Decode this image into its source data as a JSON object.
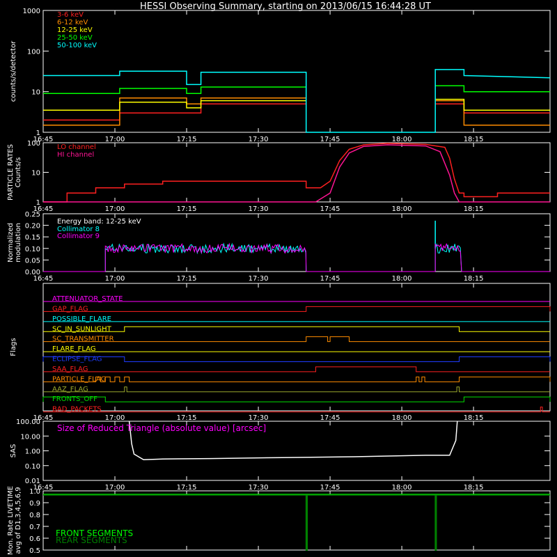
{
  "title": "HESSI Observing Summary, starting on 2013/06/15 16:44:28 UT",
  "chart_data": [
    {
      "id": "count_rates",
      "type": "line",
      "ylabel": "counts/s/detector",
      "yscale": "log",
      "ylim": [
        1,
        1000
      ],
      "yticks": [
        "1",
        "10",
        "100",
        "1000"
      ],
      "xlim_min": [
        0,
        106
      ],
      "xticks": [
        "16:45",
        "17:00",
        "17:15",
        "17:30",
        "17:45",
        "18:00",
        "18:15"
      ],
      "series": [
        {
          "name": "3-6 keV",
          "color": "#ff2020",
          "points": [
            [
              0,
              2
            ],
            [
              16,
              2
            ],
            [
              16,
              3
            ],
            [
              33,
              3
            ],
            [
              33,
              5
            ],
            [
              55,
              5
            ],
            [
              55,
              null
            ],
            [
              82,
              null
            ],
            [
              82,
              5
            ],
            [
              88,
              5
            ],
            [
              88,
              3
            ],
            [
              106,
              3
            ]
          ]
        },
        {
          "name": "6-12 keV",
          "color": "#ff8c00",
          "points": [
            [
              0,
              1.5
            ],
            [
              16,
              1.5
            ],
            [
              16,
              7
            ],
            [
              30,
              7
            ],
            [
              30,
              5
            ],
            [
              33,
              5
            ],
            [
              33,
              7
            ],
            [
              55,
              7
            ],
            [
              55,
              null
            ],
            [
              82,
              null
            ],
            [
              82,
              6
            ],
            [
              88,
              6
            ],
            [
              88,
              1.5
            ],
            [
              106,
              1.5
            ]
          ]
        },
        {
          "name": "12-25 keV",
          "color": "#ffff00",
          "points": [
            [
              0,
              3.5
            ],
            [
              16,
              3.5
            ],
            [
              16,
              5.5
            ],
            [
              30,
              5.5
            ],
            [
              30,
              4
            ],
            [
              33,
              4
            ],
            [
              33,
              6
            ],
            [
              55,
              6
            ],
            [
              55,
              null
            ],
            [
              82,
              null
            ],
            [
              82,
              6.5
            ],
            [
              88,
              6.5
            ],
            [
              88,
              3.5
            ],
            [
              106,
              3.5
            ]
          ]
        },
        {
          "name": "25-50 keV",
          "color": "#00ff00",
          "points": [
            [
              0,
              9
            ],
            [
              16,
              9
            ],
            [
              16,
              12
            ],
            [
              30,
              12
            ],
            [
              30,
              9
            ],
            [
              33,
              9
            ],
            [
              33,
              13
            ],
            [
              55,
              13
            ],
            [
              55,
              null
            ],
            [
              82,
              null
            ],
            [
              82,
              14
            ],
            [
              88,
              14
            ],
            [
              88,
              10
            ],
            [
              106,
              10
            ]
          ]
        },
        {
          "name": "50-100 keV",
          "color": "#00ffff",
          "points": [
            [
              0,
              25
            ],
            [
              16,
              25
            ],
            [
              16,
              32
            ],
            [
              30,
              32
            ],
            [
              30,
              15
            ],
            [
              33,
              15
            ],
            [
              33,
              30
            ],
            [
              55,
              30
            ],
            [
              55,
              1
            ],
            [
              82,
              1
            ],
            [
              82,
              35
            ],
            [
              88,
              35
            ],
            [
              88,
              25
            ],
            [
              106,
              22
            ]
          ]
        }
      ]
    },
    {
      "id": "particle_rates",
      "type": "line",
      "ylabel": "PARTICLE RATES",
      "ylabel2": "Counts/s",
      "yscale": "log",
      "ylim": [
        1,
        100
      ],
      "yticks": [
        "1",
        "10",
        "100"
      ],
      "xlim_min": [
        0,
        106
      ],
      "xticks": [
        "16:45",
        "17:00",
        "17:15",
        "17:30",
        "17:45",
        "18:00",
        "18:15"
      ],
      "series": [
        {
          "name": "LO channel",
          "color": "#ff2020",
          "points": [
            [
              0,
              1
            ],
            [
              5,
              1
            ],
            [
              5,
              2
            ],
            [
              11,
              2
            ],
            [
              11,
              3
            ],
            [
              17,
              3
            ],
            [
              17,
              4
            ],
            [
              25,
              4
            ],
            [
              25,
              5
            ],
            [
              55,
              5
            ],
            [
              55,
              3
            ],
            [
              58,
              3
            ],
            [
              60,
              5
            ],
            [
              62,
              25
            ],
            [
              64,
              60
            ],
            [
              67,
              85
            ],
            [
              72,
              95
            ],
            [
              80,
              88
            ],
            [
              84,
              70
            ],
            [
              85,
              30
            ],
            [
              86,
              6
            ],
            [
              87,
              2
            ],
            [
              88,
              2
            ],
            [
              88,
              1.5
            ],
            [
              95,
              1.5
            ],
            [
              95,
              2
            ],
            [
              106,
              2
            ]
          ]
        },
        {
          "name": "HI channel",
          "color": "#ff1493",
          "points": [
            [
              0,
              1
            ],
            [
              57,
              1
            ],
            [
              60,
              2
            ],
            [
              62,
              15
            ],
            [
              64,
              45
            ],
            [
              67,
              75
            ],
            [
              72,
              85
            ],
            [
              80,
              78
            ],
            [
              83,
              50
            ],
            [
              85,
              8
            ],
            [
              86,
              2
            ],
            [
              87,
              1
            ],
            [
              106,
              1
            ]
          ]
        }
      ]
    },
    {
      "id": "modulation",
      "type": "line",
      "ylabel": "Normalized",
      "ylabel2": "modulation",
      "ylim": [
        0,
        0.25
      ],
      "yticks": [
        "0.00",
        "0.05",
        "0.10",
        "0.15",
        "0.20",
        "0.25"
      ],
      "annotation": "Energy band: 12-25 keV",
      "xlim_min": [
        0,
        106
      ],
      "xticks": [
        "16:45",
        "17:00",
        "17:15",
        "17:30",
        "17:45",
        "18:00",
        "18:15"
      ],
      "series": [
        {
          "name": "Collimator 8",
          "color": "#00ffff",
          "segments": [
            {
              "x": [
                13,
                55
              ],
              "y": 0.1
            },
            {
              "x": [
                82,
                87.5
              ],
              "y": 0.1
            }
          ],
          "spike": [
            82,
            0.22
          ]
        },
        {
          "name": "Collimator 9",
          "color": "#ff00ff",
          "segments": [
            {
              "x": [
                13,
                55
              ],
              "y": 0.1
            },
            {
              "x": [
                82,
                87.5
              ],
              "y": 0.1
            }
          ]
        }
      ]
    },
    {
      "id": "flags",
      "type": "line",
      "ylabel": "Flags",
      "xlim_min": [
        0,
        106
      ],
      "xticks": [
        "16:45",
        "17:00",
        "17:15",
        "17:30",
        "17:45",
        "18:00",
        "18:15"
      ],
      "flags": [
        {
          "name": "ATTENUATOR_STATE",
          "color": "#ff00ff",
          "high": []
        },
        {
          "name": "GAP_FLAG",
          "color": "#ff2020",
          "high": [
            [
              55,
              106
            ]
          ]
        },
        {
          "name": "POSSIBLE_FLARE",
          "color": "#00ffff",
          "high": []
        },
        {
          "name": "SC_IN_SUNLIGHT",
          "color": "#ffff00",
          "high": [
            [
              17,
              87
            ]
          ]
        },
        {
          "name": "SC_TRANSMITTER",
          "color": "#ff8c00",
          "high": [
            [
              55,
              59.5
            ],
            [
              60,
              64
            ]
          ]
        },
        {
          "name": "FLARE_FLAG",
          "color": "#ffff00",
          "high": []
        },
        {
          "name": "ECLIPSE_FLAG",
          "color": "#1e3cff",
          "high": [
            [
              0,
              17
            ],
            [
              87,
              106
            ]
          ]
        },
        {
          "name": "SAA_FLAG",
          "color": "#ff2020",
          "high": [
            [
              57,
              78
            ]
          ]
        },
        {
          "name": "PARTICLE_FLAG",
          "color": "#ff8c00",
          "high": [
            [
              11,
              12
            ],
            [
              13,
              14
            ],
            [
              15,
              16
            ],
            [
              17,
              18
            ],
            [
              78,
              78.6
            ],
            [
              79.2,
              79.8
            ],
            [
              87,
              106
            ]
          ]
        },
        {
          "name": "AAZ_FLAG",
          "color": "#9aa82c",
          "high": [
            [
              17,
              17.5
            ],
            [
              86.5,
              87
            ]
          ]
        },
        {
          "name": "FRONTS_OFF",
          "color": "#00e000",
          "high": [
            [
              0,
              13
            ],
            [
              88,
              106
            ]
          ]
        },
        {
          "name": "BAD_PACKETS",
          "color": "#ff2020",
          "high": [
            [
              104,
              104.4
            ]
          ]
        }
      ]
    },
    {
      "id": "sas",
      "type": "line",
      "ylabel": "SAS",
      "yscale": "log",
      "ylim": [
        0.01,
        100
      ],
      "yticks": [
        "0.01",
        "0.10",
        "1.00",
        "10.00",
        "100.00"
      ],
      "annotation": "Size of Reduced Triangle (absolute value) [arcsec]",
      "xlim_min": [
        0,
        106
      ],
      "xticks": [
        "16:45",
        "17:00",
        "17:15",
        "17:30",
        "17:45",
        "18:00",
        "18:15"
      ],
      "series": [
        {
          "name": "",
          "color": "#ffffff",
          "points": [
            [
              18,
              100
            ],
            [
              18.5,
              3
            ],
            [
              19,
              0.6
            ],
            [
              21,
              0.25
            ],
            [
              25,
              0.28
            ],
            [
              35,
              0.3
            ],
            [
              50,
              0.35
            ],
            [
              65,
              0.4
            ],
            [
              80,
              0.5
            ],
            [
              85,
              0.5
            ],
            [
              86.3,
              5
            ],
            [
              86.6,
              100
            ]
          ]
        }
      ]
    },
    {
      "id": "livetime",
      "type": "line",
      "ylabel": "Mon. Rate LIVETIME",
      "ylabel2": "avg of D1,3,4,5,6,9",
      "ylim": [
        0.5,
        1.0
      ],
      "yticks": [
        "0.5",
        "0.6",
        "0.7",
        "0.8",
        "0.9",
        "1.0"
      ],
      "xlim_min": [
        0,
        106
      ],
      "series": [
        {
          "name": "FRONT SEGMENTS",
          "color": "#00ff00",
          "points": [
            [
              0,
              0.97
            ],
            [
              55,
              0.97
            ],
            [
              55,
              0.5
            ],
            [
              55.2,
              0.5
            ],
            [
              55.2,
              0.97
            ],
            [
              82,
              0.97
            ],
            [
              82,
              0.5
            ],
            [
              82.2,
              0.5
            ],
            [
              82.2,
              0.97
            ],
            [
              106,
              0.97
            ]
          ]
        },
        {
          "name": "REAR SEGMENTS",
          "color": "#008000",
          "points": [
            [
              0,
              0.965
            ],
            [
              55,
              0.965
            ],
            [
              55,
              0.5
            ],
            [
              55.2,
              0.5
            ],
            [
              55.2,
              0.965
            ],
            [
              82,
              0.965
            ],
            [
              82,
              0.5
            ],
            [
              82.2,
              0.5
            ],
            [
              82.2,
              0.965
            ],
            [
              106,
              0.965
            ]
          ]
        }
      ]
    }
  ]
}
